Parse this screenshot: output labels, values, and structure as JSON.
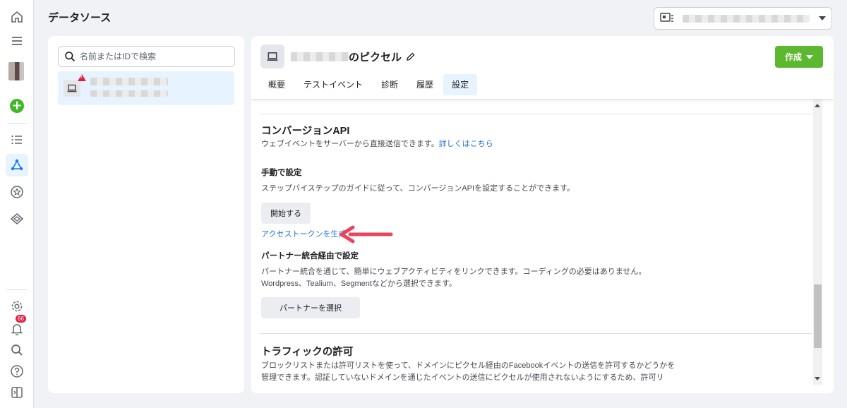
{
  "header": {
    "title": "データソース"
  },
  "rail": {
    "notification_count": "66"
  },
  "search": {
    "placeholder": "名前またはIDで検索"
  },
  "pixel": {
    "name_suffix": "のピクセル",
    "create_label": "作成"
  },
  "tabs": [
    {
      "label": "概要"
    },
    {
      "label": "テストイベント"
    },
    {
      "label": "診断"
    },
    {
      "label": "履歴"
    },
    {
      "label": "設定"
    }
  ],
  "active_tab": "設定",
  "conversions_api": {
    "title": "コンバージョンAPI",
    "description": "ウェブイベントをサーバーから直接送信できます。",
    "learn_more": "詳しくはこちら",
    "manual_title": "手動で設定",
    "manual_desc": "ステップバイステップのガイドに従って、コンバージョンAPIを設定することができます。",
    "start_button": "開始する",
    "access_token_link": "アクセストークンを生成",
    "partner_title": "パートナー統合経由で設定",
    "partner_desc_1": "パートナー統合を通じて、簡単にウェブアクティビティをリンクできます。コーディングの必要はありません。",
    "partner_desc_2": "Wordpress、Tealium、Segmentなどから選択できます。",
    "partner_button": "パートナーを選択"
  },
  "traffic": {
    "title": "トラフィックの許可",
    "desc_1": "ブロックリストまたは許可リストを使って、ドメインにピクセル経由のFacebookイベントの送信を許可するかどうかを",
    "desc_2": "管理できます。認証していないドメインを通じたイベントの送信にピクセルが使用されないようにするため、許可リ"
  },
  "colors": {
    "accent": "#216fdb",
    "create_button": "#5cb82e",
    "annotation_arrow": "#e8445a"
  }
}
